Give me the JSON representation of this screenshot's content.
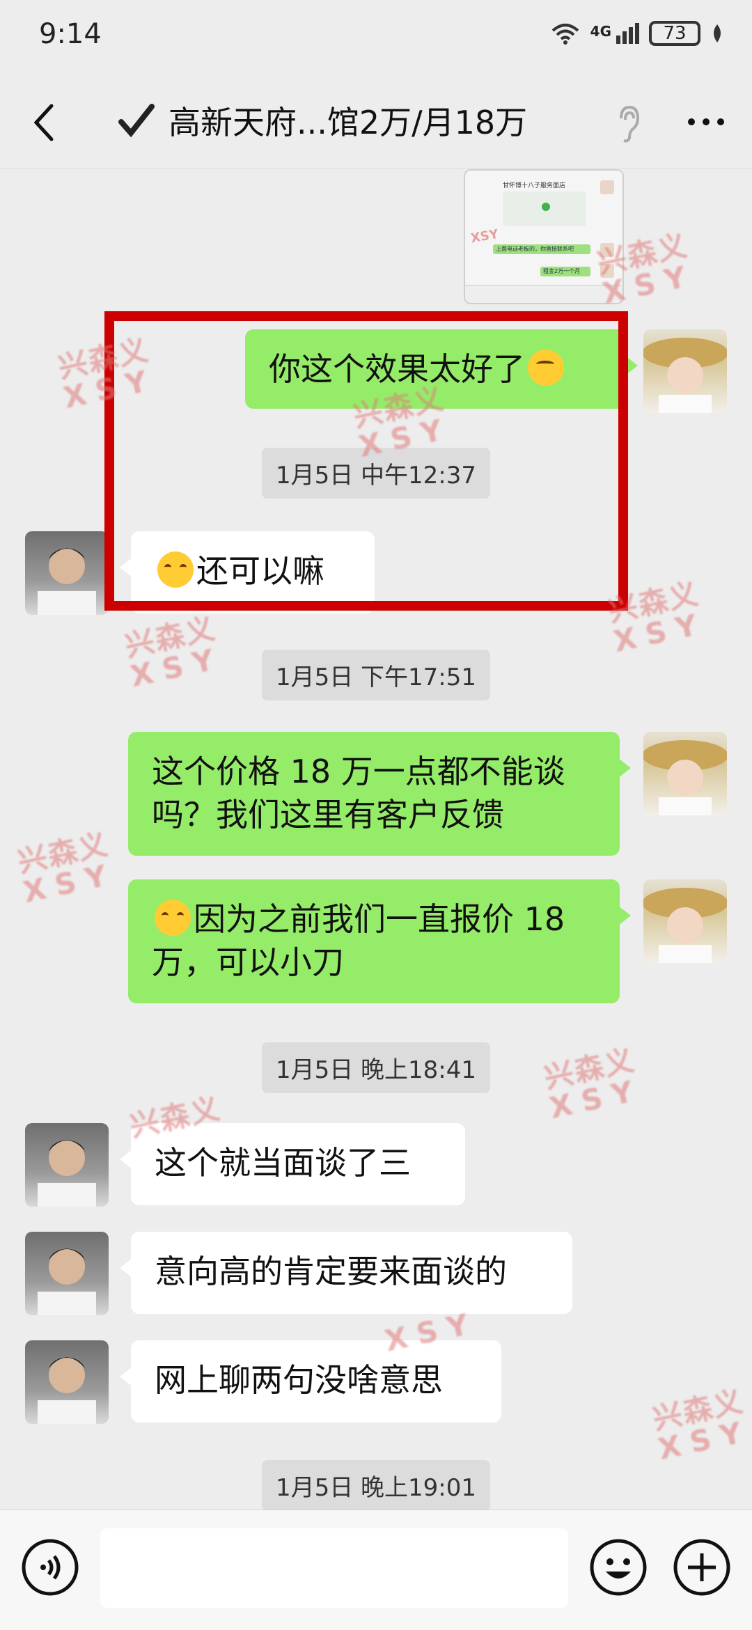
{
  "status": {
    "time": "9:14",
    "network": "4G",
    "battery": "73"
  },
  "header": {
    "title": "高新天府...馆2万/月18万"
  },
  "thumbnail": {
    "title": "甘怀博十八子服务面店",
    "line1": "上面电话老板的，你直接联系吧",
    "line2": "租金2万一个月"
  },
  "messages": [
    {
      "side": "right",
      "text": "你这个效果太好了",
      "emoji": "thinking-face"
    },
    {
      "type": "timestamp",
      "text": "1月5日 中午12:37"
    },
    {
      "side": "left",
      "text": "还可以嘛",
      "emoji_prefix": "crying-face"
    },
    {
      "type": "timestamp",
      "text": "1月5日 下午17:51"
    },
    {
      "side": "right",
      "text": "这个价格 18 万一点都不能谈吗？我们这里有客户反馈"
    },
    {
      "side": "right",
      "text": "因为之前我们一直报价 18 万，可以小刀",
      "emoji_prefix": "crying-face"
    },
    {
      "type": "timestamp",
      "text": "1月5日 晚上18:41"
    },
    {
      "side": "left",
      "text": "这个就当面谈了三"
    },
    {
      "side": "left",
      "text": "意向高的肯定要来面谈的"
    },
    {
      "side": "left",
      "text": "网上聊两句没啥意思"
    },
    {
      "type": "timestamp",
      "text": "1月5日 晚上19:01"
    }
  ],
  "watermark": {
    "zh": "兴森义",
    "en": "XSY"
  },
  "colors": {
    "bubble_green": "#95ec69",
    "bubble_white": "#ffffff",
    "highlight_red": "#cc0000",
    "background": "#ededed"
  }
}
